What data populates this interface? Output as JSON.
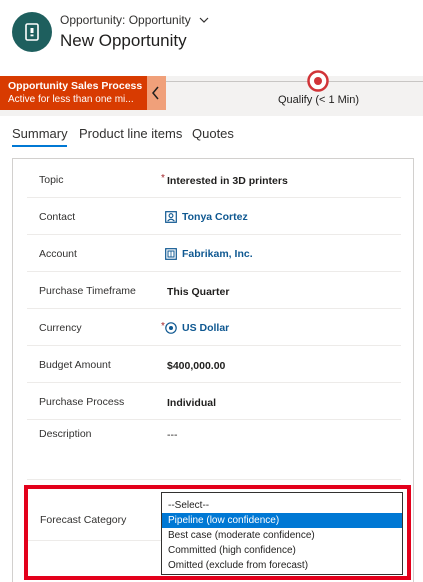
{
  "header": {
    "entity_type": "Opportunity: Opportunity",
    "record_title": "New Opportunity"
  },
  "bpf": {
    "process_name": "Opportunity Sales Process",
    "process_status": "Active for less than one mi...",
    "stage_label": "Qualify",
    "stage_duration": "(< 1 Min)"
  },
  "tabs": [
    {
      "label": "Summary"
    },
    {
      "label": "Product line items"
    },
    {
      "label": "Quotes"
    }
  ],
  "form": {
    "fields": [
      {
        "label": "Topic",
        "value": "Interested in 3D printers",
        "required": "*"
      },
      {
        "label": "Contact",
        "value": "Tonya Cortez"
      },
      {
        "label": "Account",
        "value": "Fabrikam, Inc."
      },
      {
        "label": "Purchase Timeframe",
        "value": "This Quarter"
      },
      {
        "label": "Currency",
        "value": "US Dollar",
        "required": "*"
      },
      {
        "label": "Budget Amount",
        "value": "$400,000.00"
      },
      {
        "label": "Purchase Process",
        "value": "Individual"
      },
      {
        "label": "Description",
        "value": "---"
      }
    ],
    "forecast_label": "Forecast Category"
  },
  "dropdown": {
    "options": [
      {
        "label": "--Select--",
        "selected": false
      },
      {
        "label": "Pipeline (low confidence)",
        "selected": true
      },
      {
        "label": "Best case (moderate confidence)",
        "selected": false
      },
      {
        "label": "Committed (high confidence)",
        "selected": false
      },
      {
        "label": "Omitted (exclude from forecast)",
        "selected": false
      }
    ]
  },
  "colors": {
    "entity_icon": "#1e5f5e",
    "bpf_active": "#d83b01",
    "link": "#0f5891",
    "accent": "#0078d4",
    "highlight": "#e3001b"
  },
  "icons": {
    "entity": "opportunity-icon",
    "contact": "contact-icon",
    "account": "account-icon",
    "currency": "currency-icon"
  }
}
